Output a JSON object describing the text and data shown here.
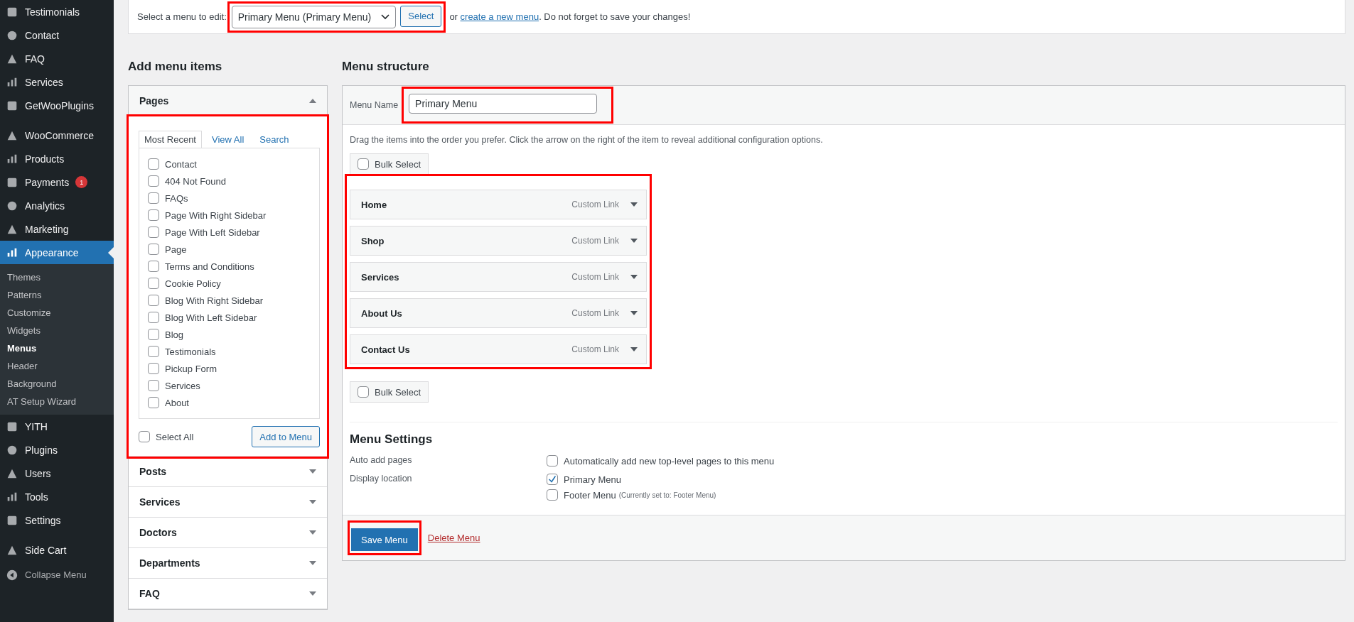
{
  "sidebar": {
    "items": [
      {
        "kind": "item",
        "label": "Testimonials",
        "selected": false
      },
      {
        "kind": "item",
        "label": "Contact",
        "selected": false
      },
      {
        "kind": "item",
        "label": "FAQ",
        "selected": false
      },
      {
        "kind": "item",
        "label": "Services",
        "selected": false
      },
      {
        "kind": "item",
        "label": "GetWooPlugins",
        "selected": false
      },
      {
        "kind": "separator"
      },
      {
        "kind": "item",
        "label": "WooCommerce",
        "selected": false
      },
      {
        "kind": "item",
        "label": "Products",
        "selected": false
      },
      {
        "kind": "item",
        "label": "Payments",
        "selected": false,
        "badge": "1"
      },
      {
        "kind": "item",
        "label": "Analytics",
        "selected": false
      },
      {
        "kind": "item",
        "label": "Marketing",
        "selected": false
      },
      {
        "kind": "item",
        "label": "Appearance",
        "selected": true,
        "children": [
          {
            "label": "Themes",
            "selected": false
          },
          {
            "label": "Patterns",
            "selected": false
          },
          {
            "label": "Customize",
            "selected": false
          },
          {
            "label": "Widgets",
            "selected": false
          },
          {
            "label": "Menus",
            "selected": true
          },
          {
            "label": "Header",
            "selected": false
          },
          {
            "label": "Background",
            "selected": false
          },
          {
            "label": "AT Setup Wizard",
            "selected": false
          }
        ]
      },
      {
        "kind": "item",
        "label": "YITH",
        "selected": false
      },
      {
        "kind": "item",
        "label": "Plugins",
        "selected": false
      },
      {
        "kind": "item",
        "label": "Users",
        "selected": false
      },
      {
        "kind": "item",
        "label": "Tools",
        "selected": false
      },
      {
        "kind": "item",
        "label": "Settings",
        "selected": false
      },
      {
        "kind": "separator"
      },
      {
        "kind": "item",
        "label": "Side Cart",
        "selected": false
      }
    ],
    "collapse_label": "Collapse Menu"
  },
  "menu_select": {
    "label": "Select a menu to edit:",
    "value": "Primary Menu (Primary Menu)",
    "button": "Select",
    "highlighted": true,
    "before_link": "or ",
    "link": "create a new menu",
    "after_link": ". Do not forget to save your changes!"
  },
  "add_menu_items": {
    "heading": "Add menu items",
    "metaboxes": [
      {
        "title": "Pages",
        "expanded": true,
        "highlighted": true,
        "tabs": [
          {
            "label": "Most Recent",
            "selected": true
          },
          {
            "label": "View All",
            "selected": false
          },
          {
            "label": "Search",
            "selected": false
          }
        ],
        "pages": [
          {
            "label": "Contact",
            "checked": false
          },
          {
            "label": "404 Not Found",
            "checked": false
          },
          {
            "label": "FAQs",
            "checked": false
          },
          {
            "label": "Page With Right Sidebar",
            "checked": false
          },
          {
            "label": "Page With Left Sidebar",
            "checked": false
          },
          {
            "label": "Page",
            "checked": false
          },
          {
            "label": "Terms and Conditions",
            "checked": false
          },
          {
            "label": "Cookie Policy",
            "checked": false
          },
          {
            "label": "Blog With Right Sidebar",
            "checked": false
          },
          {
            "label": "Blog With Left Sidebar",
            "checked": false
          },
          {
            "label": "Blog",
            "checked": false
          },
          {
            "label": "Testimonials",
            "checked": false
          },
          {
            "label": "Pickup Form",
            "checked": false
          },
          {
            "label": "Services",
            "checked": false
          },
          {
            "label": "About",
            "checked": false
          }
        ],
        "select_all": {
          "label": "Select All",
          "checked": false
        },
        "add_button": "Add to Menu"
      },
      {
        "title": "Posts",
        "expanded": false
      },
      {
        "title": "Services",
        "expanded": false
      },
      {
        "title": "Doctors",
        "expanded": false
      },
      {
        "title": "Departments",
        "expanded": false
      },
      {
        "title": "FAQ",
        "expanded": false
      }
    ]
  },
  "menu_structure": {
    "heading": "Menu structure",
    "name_label": "Menu Name",
    "name_value": "Primary Menu",
    "name_highlighted": true,
    "instructions": "Drag the items into the order you prefer. Click the arrow on the right of the item to reveal additional configuration options.",
    "bulk_select_top": {
      "label": "Bulk Select",
      "checked": false
    },
    "items_highlighted": true,
    "items": [
      {
        "title": "Home",
        "type": "Custom Link"
      },
      {
        "title": "Shop",
        "type": "Custom Link"
      },
      {
        "title": "Services",
        "type": "Custom Link"
      },
      {
        "title": "About Us",
        "type": "Custom Link"
      },
      {
        "title": "Contact Us",
        "type": "Custom Link"
      }
    ],
    "bulk_select_bottom": {
      "label": "Bulk Select",
      "checked": false
    },
    "settings_heading": "Menu Settings",
    "auto_add": {
      "label": "Auto add pages",
      "option": {
        "label": "Automatically add new top-level pages to this menu",
        "checked": false
      }
    },
    "display_location": {
      "label": "Display location",
      "options": [
        {
          "label": "Primary Menu",
          "checked": true
        },
        {
          "label": "Footer Menu",
          "note": "(Currently set to: Footer Menu)",
          "checked": false
        }
      ]
    },
    "save_button": "Save Menu",
    "save_highlighted": true,
    "delete_link": "Delete Menu"
  }
}
